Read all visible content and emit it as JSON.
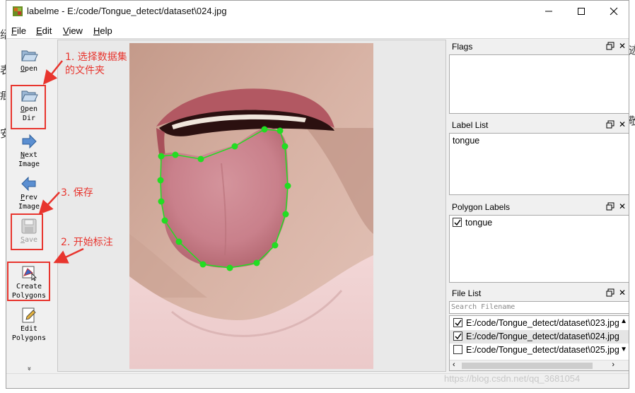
{
  "window": {
    "title": "labelme - E:/code/Tongue_detect/dataset\\024.jpg"
  },
  "menu": [
    {
      "mnemonic": "F",
      "rest": "ile"
    },
    {
      "mnemonic": "E",
      "rest": "dit"
    },
    {
      "mnemonic": "V",
      "rest": "iew"
    },
    {
      "mnemonic": "H",
      "rest": "elp"
    }
  ],
  "toolbar": {
    "open": {
      "u": "O",
      "rest": "pen"
    },
    "open_dir": {
      "line1_u": "O",
      "line1_rest": "pen",
      "line2": "Dir"
    },
    "next_image": {
      "line1_u": "N",
      "line1_rest": "ext",
      "line2": "Image"
    },
    "prev_image": {
      "line1_u": "P",
      "line1_rest": "rev",
      "line2": "Image"
    },
    "save": {
      "u": "S",
      "rest": "ave"
    },
    "create_polygons": {
      "line1": "Create",
      "line2": "Polygons"
    },
    "edit_polygons": {
      "line1": "Edit",
      "line2": "Polygons"
    },
    "more": "»"
  },
  "docks": {
    "flags": {
      "title": "Flags"
    },
    "label_list": {
      "title": "Label List",
      "items": [
        "tongue"
      ]
    },
    "polygon_labels": {
      "title": "Polygon Labels",
      "items": [
        {
          "label": "tongue",
          "checked": true
        }
      ]
    },
    "file_list": {
      "title": "File List",
      "search_placeholder": "Search Filename",
      "files": [
        {
          "name": "E:/code/Tongue_detect/dataset\\023.jpg",
          "checked": true,
          "selected": false
        },
        {
          "name": "E:/code/Tongue_detect/dataset\\024.jpg",
          "checked": true,
          "selected": true
        },
        {
          "name": "E:/code/Tongue_detect/dataset\\025.jpg",
          "checked": false,
          "selected": false
        }
      ]
    }
  },
  "annotations": {
    "step1_line1": "1.  选择数据集",
    "step1_line2": "的文件夹",
    "step2": "2.  开始标注",
    "step3": "3.  保存"
  },
  "background_text": [
    "绍",
    "表",
    "痕",
    "迹",
    "敬",
    "安"
  ],
  "watermark": "https://blog.csdn.net/qq_3681054",
  "colors": {
    "annotation": "#e8352e",
    "polygon": "#22dd22"
  }
}
